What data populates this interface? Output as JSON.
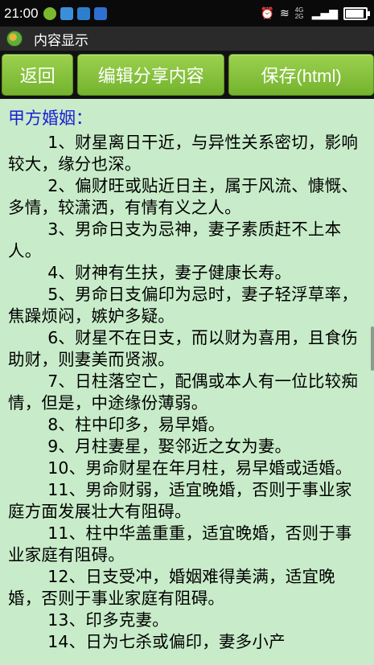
{
  "status_bar": {
    "time": "21:00",
    "network_type": "4G 2G",
    "battery_level": 0.85
  },
  "title_bar": {
    "title": "内容显示"
  },
  "buttons": {
    "back": "返回",
    "edit_share": "编辑分享内容",
    "save": "保存(html)"
  },
  "content": {
    "heading": "甲方婚姻：",
    "items": [
      "1、财星离日干近，与异性关系密切，影响较大，缘分也深。",
      "2、偏财旺或贴近日主，属于风流、慷慨、多情，较潇洒，有情有义之人。",
      "3、男命日支为忌神，妻子素质赶不上本人。",
      "4、财神有生扶，妻子健康长寿。",
      "5、男命日支偏印为忌时，妻子轻浮草率，焦躁烦闷，嫉妒多疑。",
      "6、财星不在日支，而以财为喜用，且食伤助财，则妻美而贤淑。",
      "7、日柱落空亡，配偶或本人有一位比较痴情，但是，中途缘份薄弱。",
      "8、柱中印多，易早婚。",
      "9、月柱妻星，娶邻近之女为妻。",
      "10、男命财星在年月柱，易早婚或适婚。",
      "11、男命财弱，适宜晚婚，否则于事业家庭方面发展壮大有阻碍。",
      "11、柱中华盖重重，适宜晚婚，否则于事业家庭有阻碍。",
      "12、日支受冲，婚姻难得美满，适宜晚婚，否则于事业家庭有阻碍。",
      "13、印多克妻。",
      "14、日为七杀或偏印，妻多小产"
    ]
  }
}
